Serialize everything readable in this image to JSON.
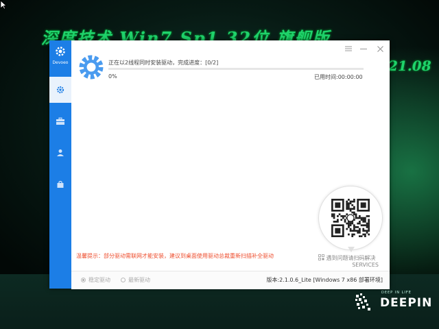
{
  "wallpaper": {
    "title": "深度技术 Win7 Sp1 32位 旗舰版",
    "date": "21.08",
    "brand_small": "DEEP IN LIFE",
    "brand_big": "DEEPIN"
  },
  "app": {
    "sidebar": {
      "logo_text": "Devoeo"
    },
    "status": "正在以2线程同时安装驱动，完成进度：[0/2]",
    "progress": {
      "percent_label": "0%",
      "value": 0
    },
    "elapsed": "已用时间:00:00:00",
    "warning": "温馨提示：部分驱动需联网才能安装，建议到桌面使用驱动总裁重新扫描补全驱动",
    "qr": {
      "line1": "遇到问题请扫码解决",
      "line2": "SERVICES"
    },
    "footer": {
      "radio_stable": "稳定驱动",
      "radio_latest": "最新驱动",
      "version": "版本:2.1.0.6_Lite [Windows 7 x86 部署环境]"
    }
  },
  "colors": {
    "accent": "#1c7ee6",
    "warning": "#ee4d2d",
    "wallpaper_text": "#1fd36b"
  },
  "icons": {
    "sidebar": [
      "gear-icon",
      "toolbox-icon",
      "user-icon",
      "bag-icon"
    ],
    "titlebar": [
      "menu-icon",
      "minimize-icon",
      "close-icon"
    ]
  }
}
